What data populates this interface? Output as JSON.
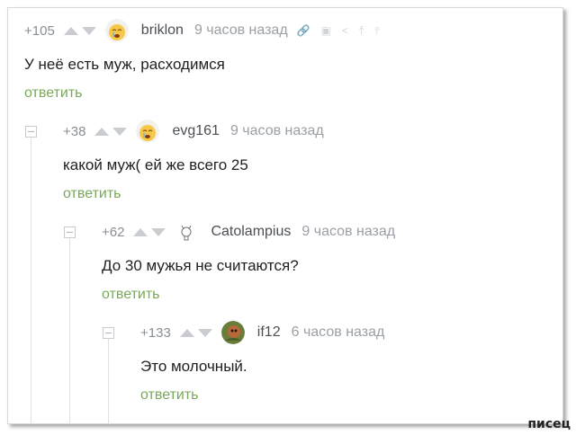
{
  "reply_label": "ответить",
  "comments": [
    {
      "rating": "+105",
      "author": "briklon",
      "time": "9 часов назад",
      "text": "У неё есть муж, расходимся",
      "avatar": "crying-emoji-avatar",
      "tools": [
        "link-icon",
        "save-icon",
        "share-icon",
        "scroll-up-icon",
        "branch-icon"
      ]
    },
    {
      "rating": "+38",
      "author": "evg161",
      "time": "9 часов назад",
      "text": "какой муж( ей же всего 25",
      "avatar": "crying-emoji-avatar"
    },
    {
      "rating": "+62",
      "author": "Catolampius",
      "time": "9 часов назад",
      "text": "До 30 мужья не считаются?",
      "avatar": "lamp-cat-avatar"
    },
    {
      "rating": "+133",
      "author": "if12",
      "time": "6 часов назад",
      "text": "Это молочный.",
      "avatar": "photo-avatar"
    }
  ],
  "watermark": "писец",
  "colors": {
    "reply": "#7aa85a",
    "rating": "#8a8f95",
    "time": "#9ba0a6",
    "arrows": "#c9ccd0"
  }
}
